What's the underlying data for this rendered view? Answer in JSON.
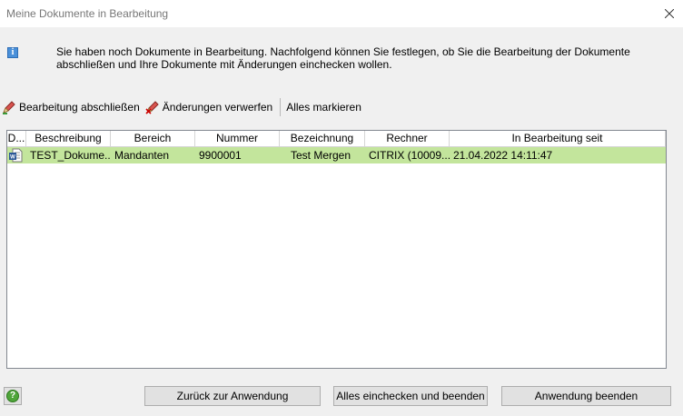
{
  "window": {
    "title": "Meine Dokumente in Bearbeitung"
  },
  "info": {
    "text": "Sie haben noch Dokumente in Bearbeitung. Nachfolgend können Sie festlegen, ob Sie die Bearbeitung der Dokumente abschließen und Ihre Dokumente mit Änderungen einchecken wollen."
  },
  "toolbar": {
    "finish_label": "Bearbeitung abschließen",
    "discard_label": "Änderungen verwerfen",
    "select_all_label": "Alles markieren"
  },
  "table": {
    "columns": [
      "D...",
      "Beschreibung",
      "Bereich",
      "Nummer",
      "Bezeichnung",
      "Rechner",
      "In Bearbeitung seit"
    ],
    "rows": [
      {
        "icon": "word-document-icon",
        "beschreibung": "TEST_Dokume...",
        "bereich": "Mandanten",
        "nummer": "9900001",
        "bezeichnung": "Test Mergen",
        "rechner": "CITRIX (10009...",
        "seit": "21.04.2022 14:11:47"
      }
    ],
    "selected_row_color": "#c3e59c"
  },
  "buttons": {
    "back": "Zurück zur Anwendung",
    "checkin_all": "Alles einchecken und beenden",
    "quit": "Anwendung beenden"
  }
}
